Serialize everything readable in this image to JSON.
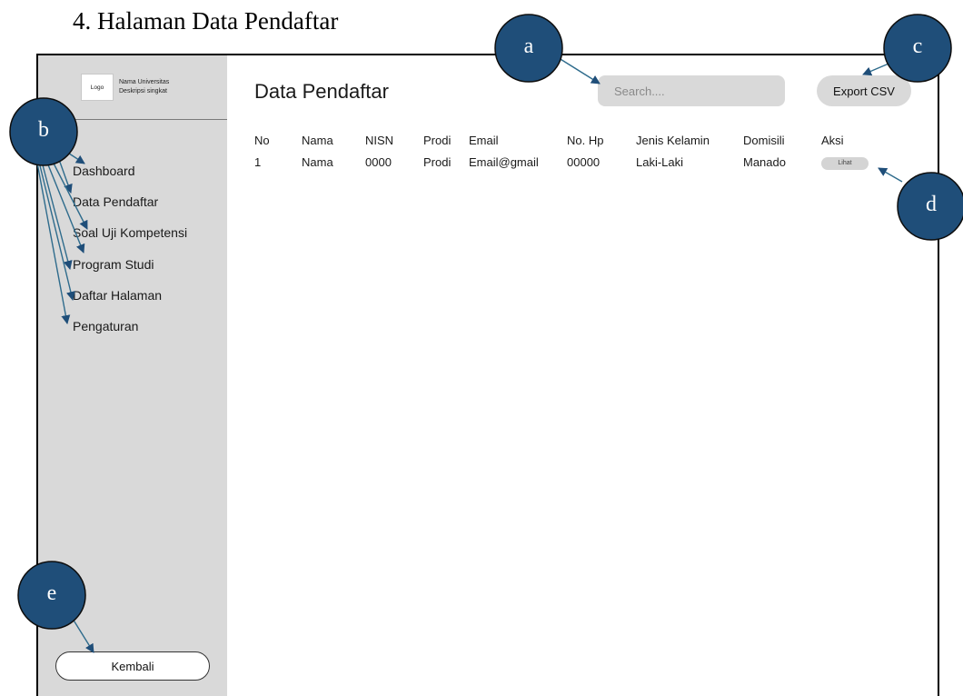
{
  "document": {
    "heading": "4.   Halaman Data Pendaftar"
  },
  "sidebar": {
    "logo_text": "Logo",
    "university_name": "Nama Universitas",
    "university_desc": "Deskripsi singkat",
    "items": [
      {
        "label": "Dashboard"
      },
      {
        "label": "Data Pendaftar"
      },
      {
        "label": "Soal Uji Kompetensi"
      },
      {
        "label": "Program Studi"
      },
      {
        "label": "Daftar Halaman"
      },
      {
        "label": "Pengaturan"
      }
    ],
    "back_label": "Kembali"
  },
  "main": {
    "title": "Data Pendaftar",
    "search": {
      "placeholder": "Search....",
      "value": ""
    },
    "export_label": "Export CSV",
    "table": {
      "headers": [
        "No",
        "Nama",
        "NISN",
        "Prodi",
        "Email",
        "No. Hp",
        "Jenis Kelamin",
        "Domisili",
        "Aksi"
      ],
      "rows": [
        [
          "1",
          "Nama",
          "0000",
          "Prodi",
          "Email@gmail",
          "00000",
          "Laki-Laki",
          "Manado",
          "Lihat"
        ]
      ]
    }
  },
  "annotations": {
    "colors": {
      "fill": "#1f4e79",
      "stroke": "#0d0d0d",
      "arrow": "#2e6b8c",
      "text": "#ffffff"
    },
    "labels": {
      "a": "a",
      "b": "b",
      "c": "c",
      "d": "d",
      "e": "e"
    }
  }
}
